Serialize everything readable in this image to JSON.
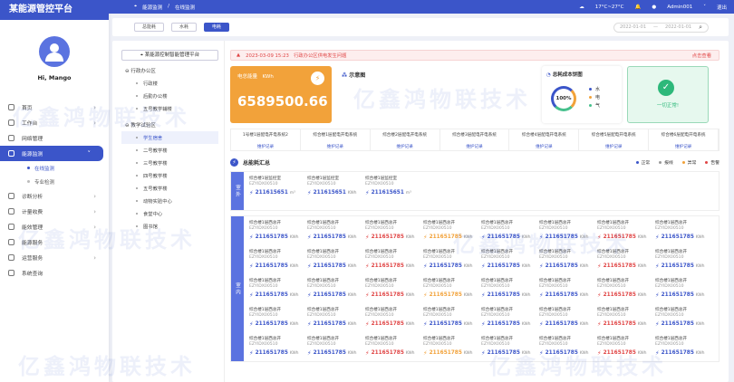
{
  "app": {
    "title": "某能源管控平台",
    "greeting": "Hi, Mango"
  },
  "menu": [
    {
      "label": "首页"
    },
    {
      "label": "工作台"
    },
    {
      "label": "网络管理"
    },
    {
      "label": "能源监测"
    },
    {
      "label": "诊断分析"
    },
    {
      "label": "计量收费"
    },
    {
      "label": "能效管理"
    },
    {
      "label": "能源服务"
    },
    {
      "label": "运营服务"
    },
    {
      "label": "系统查询"
    }
  ],
  "submenu": [
    {
      "label": "在线监测"
    },
    {
      "label": "专业检测"
    }
  ],
  "topbar": {
    "crumb1": "能源监测",
    "crumb2": "在线监测",
    "weather": "17°C~27°C",
    "user": "Admin001",
    "logout": "退出"
  },
  "tabs": [
    {
      "label": "总能耗"
    },
    {
      "label": "水耗"
    },
    {
      "label": "电耗"
    }
  ],
  "dates": {
    "start": "2022-01-01",
    "end": "2022-01-01"
  },
  "tree": {
    "header": "某能源控制智能管理平台",
    "groups": [
      {
        "label": "行政办公区",
        "items": [
          "行政楼",
          "后勤办公楼",
          "五号教学辅楼"
        ]
      },
      {
        "label": "教学试验区",
        "items": [
          "学生宿舍",
          "二号教学楼",
          "三号教学楼",
          "四号教学楼",
          "五号教学楼",
          "动物实验中心",
          "食堂中心",
          "图书馆"
        ]
      }
    ]
  },
  "alert": {
    "text": "2023-03-09 15:23　行政办公区供电发生问题",
    "link": "点击查看"
  },
  "card_energy": {
    "title": "电总能量　KWh",
    "value": "6589500.66"
  },
  "card_diagram": {
    "title": "示意图"
  },
  "card_cost": {
    "title": "总耗成本饼图",
    "percent": "100%",
    "legend": [
      "水",
      "电",
      "气"
    ]
  },
  "card_status": {
    "text": "一切正常!"
  },
  "buildings": [
    {
      "name": "1号楼1层配电开电系统2",
      "link": "维护记录"
    },
    {
      "name": "综合楼1层配电开电系统",
      "link": "维护记录"
    },
    {
      "name": "综合楼2层配电开电系统",
      "link": "维护记录"
    },
    {
      "name": "综合楼3层配电开电系统",
      "link": "维护记录"
    },
    {
      "name": "综合楼4层配电开电系统",
      "link": "维护记录"
    },
    {
      "name": "综合楼5层配电开电系统",
      "link": "维护记录"
    },
    {
      "name": "综合楼6层配电开电系统",
      "link": "维护记录"
    }
  ],
  "summary": {
    "title": "总能耗汇总",
    "legend": [
      "正常",
      "报线",
      "异常",
      "告警"
    ]
  },
  "outdoor": {
    "label": "室外",
    "cells": [
      {
        "name": "综合楼1层监控室",
        "code": "EZYIDX00510",
        "value": "211615651",
        "unit": "m³",
        "color": "#3b55c9"
      },
      {
        "name": "综合楼1层监控室",
        "code": "EZYIDX00510",
        "value": "211615651",
        "unit": "KWh",
        "color": "#3b55c9"
      },
      {
        "name": "综合楼1层监控室",
        "code": "EZYIDX00510",
        "value": "211615651",
        "unit": "m³",
        "color": "#3b55c9"
      }
    ]
  },
  "indoor": {
    "label": "室内",
    "name": "综合楼1层西总开",
    "code": "EZYIDX00510",
    "value": "211651785",
    "unit": "KWh",
    "colors": [
      [
        "#3b55c9",
        "#3b55c9",
        "#e04545",
        "#f2a23a",
        "#3b55c9",
        "#3b55c9",
        "#e04545",
        "#3b55c9"
      ],
      [
        "#3b55c9",
        "#3b55c9",
        "#e04545",
        "#3b55c9",
        "#3b55c9",
        "#3b55c9",
        "#e04545",
        "#3b55c9"
      ],
      [
        "#3b55c9",
        "#3b55c9",
        "#e04545",
        "#f2a23a",
        "#3b55c9",
        "#3b55c9",
        "#e04545",
        "#3b55c9"
      ],
      [
        "#3b55c9",
        "#3b55c9",
        "#e04545",
        "#3b55c9",
        "#3b55c9",
        "#3b55c9",
        "#e04545",
        "#3b55c9"
      ],
      [
        "#3b55c9",
        "#3b55c9",
        "#e04545",
        "#f2a23a",
        "#3b55c9",
        "#3b55c9",
        "#e04545",
        "#3b55c9"
      ]
    ]
  },
  "colors": {
    "primary": "#3b55c9",
    "orange": "#f2a23a",
    "red": "#e04545",
    "green": "#2db87a"
  }
}
